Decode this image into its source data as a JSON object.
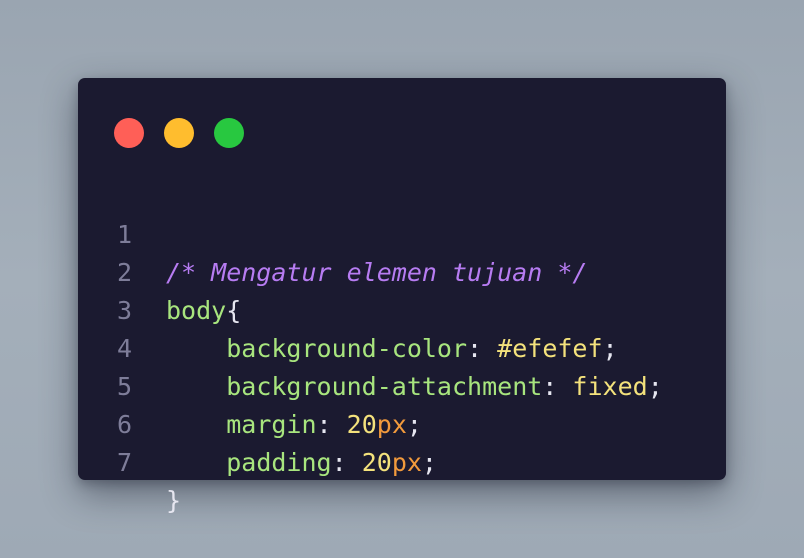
{
  "window_controls": {
    "close_color": "#ff5f57",
    "minimize_color": "#ffbd2e",
    "maximize_color": "#28c840"
  },
  "code": {
    "line_numbers": [
      "1",
      "2",
      "3",
      "4",
      "5",
      "6",
      "7"
    ],
    "line1": {
      "comment": "/* Mengatur elemen tujuan */"
    },
    "line2": {
      "selector": "body",
      "brace": "{"
    },
    "line3": {
      "property": "background-color",
      "colon": ":",
      "value": "#efefef",
      "semicolon": ";"
    },
    "line4": {
      "property": "background-attachment",
      "colon": ":",
      "value": "fixed",
      "semicolon": ";"
    },
    "line5": {
      "property": "margin",
      "colon": ":",
      "number": "20",
      "unit": "px",
      "semicolon": ";"
    },
    "line6": {
      "property": "padding",
      "colon": ":",
      "number": "20",
      "unit": "px",
      "semicolon": ";"
    },
    "line7": {
      "brace": "}"
    }
  },
  "colors": {
    "editor_background": "#1b1a30",
    "comment": "#b77cf2",
    "selector_property": "#a8e57e",
    "value": "#f4e27c",
    "unit": "#f29a3c",
    "line_number": "#7e7d99"
  }
}
